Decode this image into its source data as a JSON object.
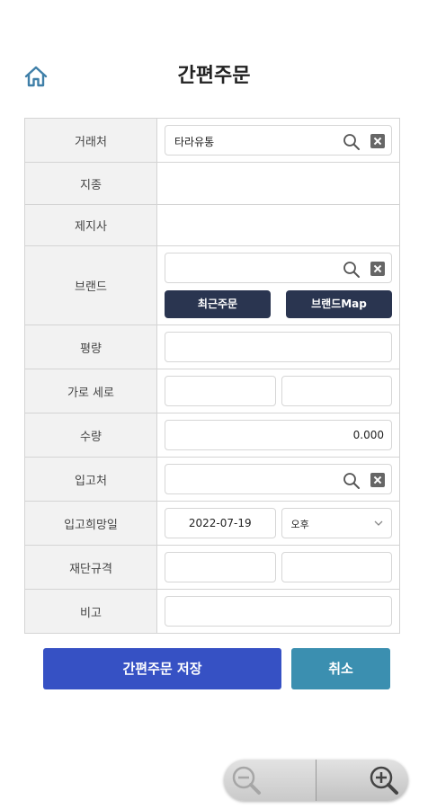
{
  "header": {
    "title": "간편주문"
  },
  "form": {
    "labels": {
      "client": "거래처",
      "branch": "지종",
      "manufacturer": "제지사",
      "brand": "브랜드",
      "weight": "평량",
      "size": "가로 세로",
      "quantity": "수량",
      "delivery_place": "입고처",
      "delivery_date": "입고희망일",
      "cut_spec": "재단규격",
      "note": "비고"
    },
    "client_value": "타라유통",
    "quantity_value": "0.000",
    "delivery_date_value": "2022-07-19",
    "ampm_value": "오후",
    "recent_order_label": "최근주문",
    "brand_map_label": "브랜드Map"
  },
  "actions": {
    "save_label": "간편주문 저장",
    "cancel_label": "취소"
  },
  "colors": {
    "save": "#3651c4",
    "cancel": "#3b8fb0",
    "dark_button": "#2a3550"
  }
}
